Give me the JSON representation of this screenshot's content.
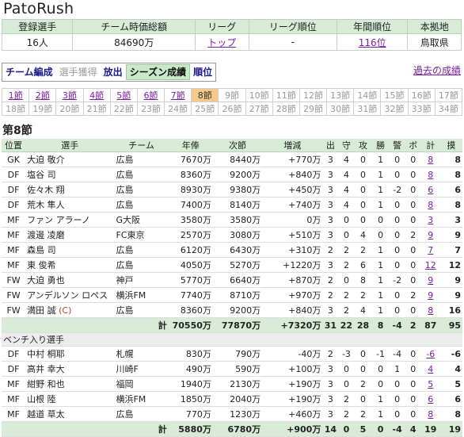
{
  "team_name": "PatoRush",
  "summary": {
    "headers": [
      "登録選手",
      "チーム時価総額",
      "リーグ",
      "リーグ順位",
      "年間順位",
      "本拠地"
    ],
    "values": [
      "16人",
      "84690万",
      "トップ",
      "-",
      "116位",
      "鳥取県"
    ]
  },
  "tabs": [
    {
      "label": "チーム編成",
      "state": "normal"
    },
    {
      "label": "選手獲得",
      "state": "dim"
    },
    {
      "label": "放出",
      "state": "normal"
    },
    {
      "label": "シーズン成績",
      "state": "active"
    },
    {
      "label": "順位",
      "state": "normal"
    }
  ],
  "past_link": "過去の成績",
  "rounds": {
    "current": "8節",
    "row1": [
      "1節",
      "2節",
      "3節",
      "4節",
      "5節",
      "6節",
      "7節",
      "8節",
      "9節",
      "10節",
      "11節",
      "12節",
      "13節",
      "14節",
      "15節",
      "16節",
      "17節"
    ],
    "row2": [
      "18節",
      "19節",
      "20節",
      "21節",
      "22節",
      "23節",
      "24節",
      "25節",
      "26節",
      "27節",
      "28節",
      "29節",
      "30節",
      "31節",
      "32節",
      "33節",
      "34節"
    ],
    "linked_row1": [
      "1節",
      "2節",
      "3節",
      "4節",
      "5節",
      "6節",
      "7節"
    ]
  },
  "section_title": "第8節",
  "columns": [
    "位置",
    "選手",
    "チーム",
    "年俸",
    "次節",
    "増減",
    "出",
    "守",
    "攻",
    "勝",
    "警",
    "ボ",
    "計",
    "摸"
  ],
  "starters": [
    [
      "GK",
      "大迫 敬介",
      "広島",
      "7670万",
      "8440万",
      "+770万",
      "3",
      "4",
      "0",
      "1",
      "0",
      "0",
      "8",
      "8"
    ],
    [
      "DF",
      "塩谷 司",
      "広島",
      "8360万",
      "9200万",
      "+840万",
      "3",
      "4",
      "0",
      "1",
      "0",
      "0",
      "8",
      "8"
    ],
    [
      "DF",
      "佐々木 翔",
      "広島",
      "8930万",
      "9380万",
      "+450万",
      "3",
      "4",
      "0",
      "1",
      "-2",
      "0",
      "6",
      "6"
    ],
    [
      "DF",
      "荒木 隼人",
      "広島",
      "7400万",
      "8140万",
      "+740万",
      "3",
      "4",
      "0",
      "1",
      "0",
      "0",
      "8",
      "8"
    ],
    [
      "MF",
      "ファン アラーノ",
      "G大阪",
      "3580万",
      "3580万",
      "0万",
      "3",
      "0",
      "0",
      "0",
      "0",
      "0",
      "3",
      "3"
    ],
    [
      "MF",
      "渡邊 凌磨",
      "FC東京",
      "2570万",
      "3080万",
      "+510万",
      "3",
      "0",
      "4",
      "0",
      "0",
      "2",
      "9",
      "9"
    ],
    [
      "MF",
      "森島 司",
      "広島",
      "6120万",
      "6430万",
      "+310万",
      "2",
      "2",
      "2",
      "1",
      "0",
      "0",
      "7",
      "7"
    ],
    [
      "MF",
      "東 俊希",
      "広島",
      "4050万",
      "5270万",
      "+1220万",
      "3",
      "2",
      "6",
      "1",
      "0",
      "0",
      "12",
      "12"
    ],
    [
      "FW",
      "大迫 勇也",
      "神戸",
      "5770万",
      "6640万",
      "+870万",
      "2",
      "0",
      "8",
      "1",
      "-2",
      "0",
      "9",
      "9"
    ],
    [
      "FW",
      "アンデルソン ロペス",
      "横浜FM",
      "7740万",
      "8710万",
      "+970万",
      "2",
      "2",
      "2",
      "1",
      "0",
      "2",
      "9",
      "9"
    ],
    [
      "FW",
      "満田 誠",
      "広島",
      "8360万",
      "9200万",
      "+840万",
      "3",
      "2",
      "4",
      "1",
      "0",
      "0",
      "8",
      "16"
    ]
  ],
  "captain_mark": "(C)",
  "starters_total": [
    "計",
    "70550万",
    "77870万",
    "+7320万",
    "31",
    "22",
    "28",
    "8",
    "-4",
    "2",
    "87",
    "95"
  ],
  "bench_label": "ベンチ入り選手",
  "bench": [
    [
      "DF",
      "中村 桐耶",
      "札幌",
      "830万",
      "790万",
      "-40万",
      "2",
      "-3",
      "0",
      "-1",
      "-4",
      "0",
      "-6",
      "-6"
    ],
    [
      "DF",
      "高井 幸大",
      "川崎F",
      "490万",
      "590万",
      "+100万",
      "3",
      "0",
      "0",
      "0",
      "1",
      "0",
      "4",
      "4"
    ],
    [
      "MF",
      "紺野 和也",
      "福岡",
      "1940万",
      "2130万",
      "+190万",
      "3",
      "0",
      "2",
      "0",
      "0",
      "0",
      "5",
      "5"
    ],
    [
      "MF",
      "山根 陸",
      "横浜FM",
      "1850万",
      "2040万",
      "+190万",
      "3",
      "2",
      "0",
      "1",
      "0",
      "0",
      "6",
      "6"
    ],
    [
      "MF",
      "越道 草太",
      "広島",
      "770万",
      "1230万",
      "+460万",
      "3",
      "2",
      "2",
      "1",
      "0",
      "0",
      "8",
      "8"
    ]
  ],
  "bench_total": [
    "計",
    "5880万",
    "6780万",
    "+900万",
    "14",
    "0",
    "5",
    "0",
    "-4",
    "4",
    "19",
    "19"
  ]
}
